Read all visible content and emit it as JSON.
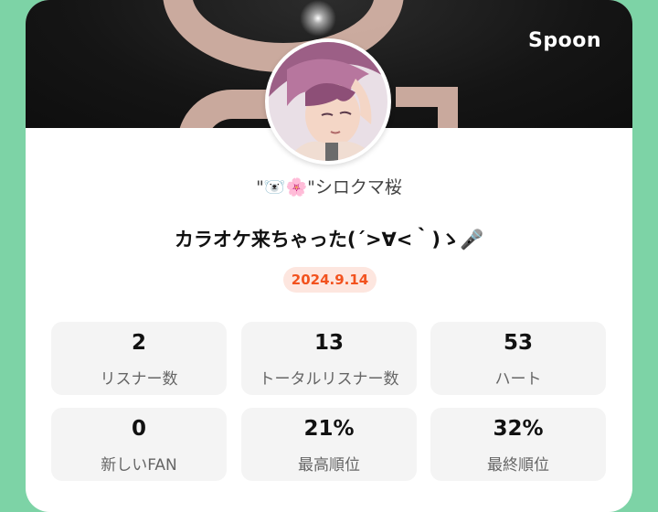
{
  "brand": "Spoon",
  "profile": {
    "username": "\"🐻‍❄️🌸\"シロクマ桜",
    "title": "カラオケ来ちゃった(´>∀<｀)ゝ🎤",
    "date": "2024.9.14"
  },
  "stats": [
    {
      "value": "2",
      "label": "リスナー数"
    },
    {
      "value": "13",
      "label": "トータルリスナー数"
    },
    {
      "value": "53",
      "label": "ハート"
    },
    {
      "value": "0",
      "label": "新しいFAN"
    },
    {
      "value": "21%",
      "label": "最高順位"
    },
    {
      "value": "32%",
      "label": "最終順位"
    }
  ],
  "colors": {
    "background": "#7dd3a6",
    "date_badge_bg": "#fde6df",
    "date_badge_text": "#f2521e"
  }
}
